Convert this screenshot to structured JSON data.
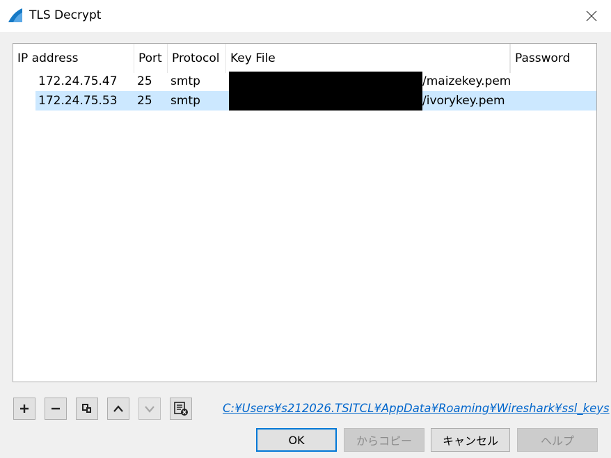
{
  "window": {
    "title": "TLS Decrypt",
    "app_icon": "wireshark-fin-icon",
    "close_icon": "close-icon"
  },
  "table": {
    "columns": [
      "IP address",
      "Port",
      "Protocol",
      "Key File",
      "Password"
    ],
    "rows": [
      {
        "ip": "172.24.75.47",
        "port": "25",
        "protocol": "smtp",
        "key_file": "/maizekey.pem",
        "password": "",
        "selected": false
      },
      {
        "ip": "172.24.75.53",
        "port": "25",
        "protocol": "smtp",
        "key_file": "/ivorykey.pem",
        "password": "",
        "selected": true
      }
    ]
  },
  "toolbar": {
    "add_icon": "plus-icon",
    "remove_icon": "minus-icon",
    "copy_icon": "copy-icon",
    "move_up_icon": "chevron-up-icon",
    "move_down_icon": "chevron-down-icon",
    "clear_icon": "clear-list-icon"
  },
  "file_path": "C:¥Users¥s212026.TSITCL¥AppData¥Roaming¥Wireshark¥ssl_keys",
  "buttons": {
    "ok": "OK",
    "copy_from": "からコピー",
    "cancel": "キャンセル",
    "help": "ヘルプ"
  },
  "colors": {
    "selection": "#cce8ff",
    "link": "#0066cc",
    "default_button_border": "#0078d7"
  }
}
